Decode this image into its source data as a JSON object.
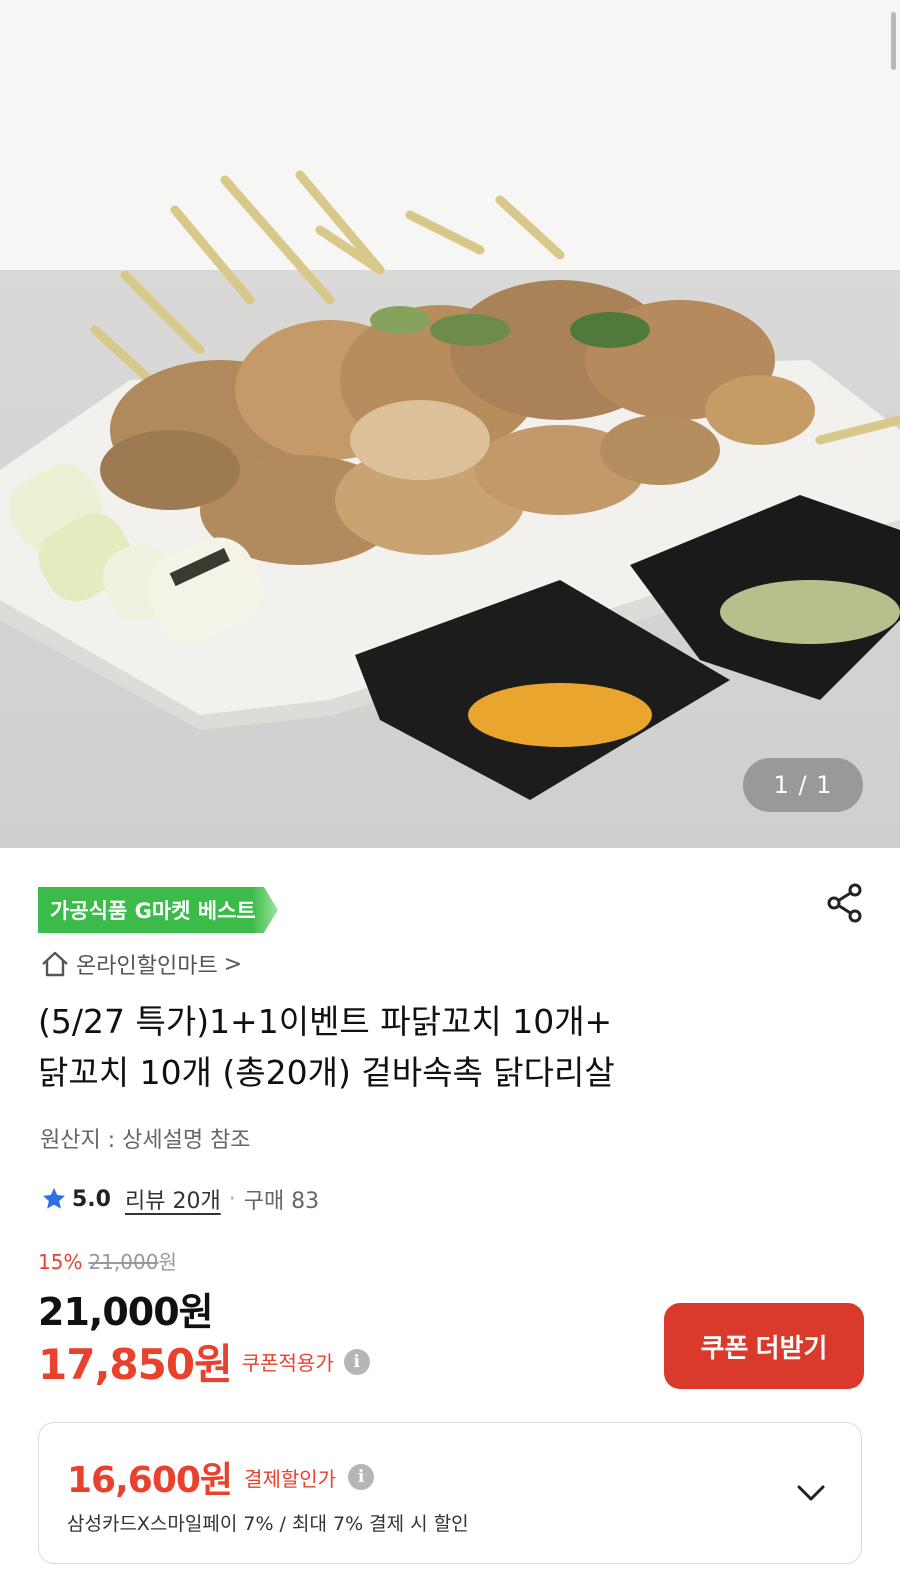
{
  "gallery": {
    "page_indicator": "1 / 1"
  },
  "badge": "가공식품 G마켓 베스트",
  "store": {
    "name": "온라인할인마트",
    "chevron": ">"
  },
  "product": {
    "title_line1": "(5/27 특가)1+1이벤트 파닭꼬치 10개+",
    "title_line2": "닭꼬치 10개 (총20개) 겉바속촉 닭다리살",
    "origin": "원산지 : 상세설명 참조"
  },
  "rating": {
    "score": "5.0",
    "reviews": "리뷰 20개",
    "separator": "·",
    "purchases": "구매 83"
  },
  "price": {
    "discount_rate": "15%",
    "original": "21,000",
    "original_unit": "원",
    "current": "21,000원",
    "coupon_price": "17,850원",
    "coupon_label": "쿠폰적용가",
    "coupon_button": "쿠폰 더받기"
  },
  "card_discount": {
    "price": "16,600원",
    "label": "결제할인가",
    "description": "삼성카드X스마일페이 7% / 최대 7% 결제 시 할인"
  },
  "icons": {
    "share": "share-icon",
    "home": "home-icon",
    "star": "star-icon",
    "info": "info-icon",
    "chevron_down": "chevron-down-icon"
  },
  "colors": {
    "accent_red": "#e8422f",
    "button_red": "#d93a2b",
    "badge_green": "#3bbb4a",
    "star_blue": "#2f6fe4"
  }
}
